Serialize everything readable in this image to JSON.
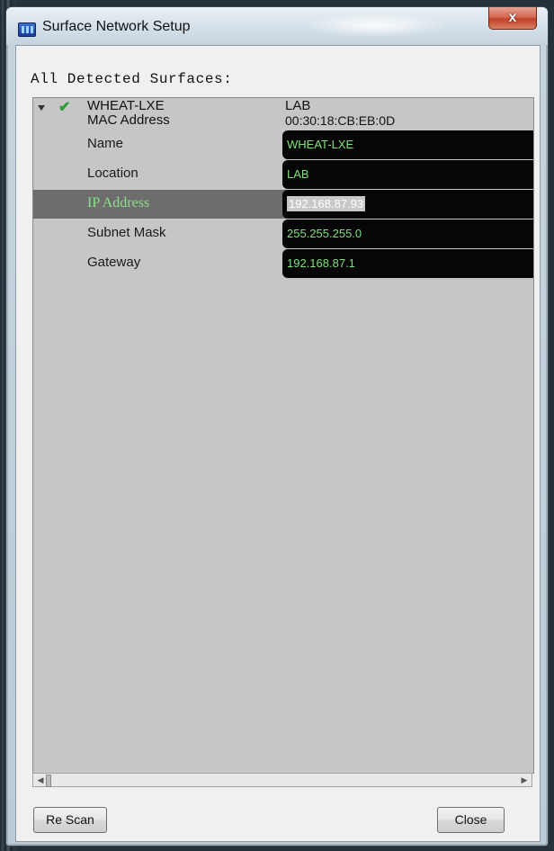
{
  "window": {
    "title": "Surface Network Setup",
    "close_glyph": "x",
    "app_icon": "network-app-icon"
  },
  "heading": "All Detected Surfaces:",
  "surface": {
    "name": "WHEAT-LXE",
    "location_header": "LAB",
    "status": "connected-check-icon",
    "mac_label": "MAC Address",
    "mac_value": "00:30:18:CB:EB:0D",
    "fields": [
      {
        "label": "Name",
        "value": "WHEAT-LXE"
      },
      {
        "label": "Location",
        "value": "LAB"
      },
      {
        "label": "IP Address",
        "value": "192.168.87.93"
      },
      {
        "label": "Subnet Mask",
        "value": "255.255.255.0"
      },
      {
        "label": "Gateway",
        "value": "192.168.87.1"
      }
    ]
  },
  "buttons": {
    "rescan": "Re Scan",
    "close": "Close"
  },
  "colors": {
    "field_bg": "#060606",
    "field_text": "#7fe07a",
    "selected_row": "#6d6d6d",
    "check": "#2e9a3b"
  }
}
